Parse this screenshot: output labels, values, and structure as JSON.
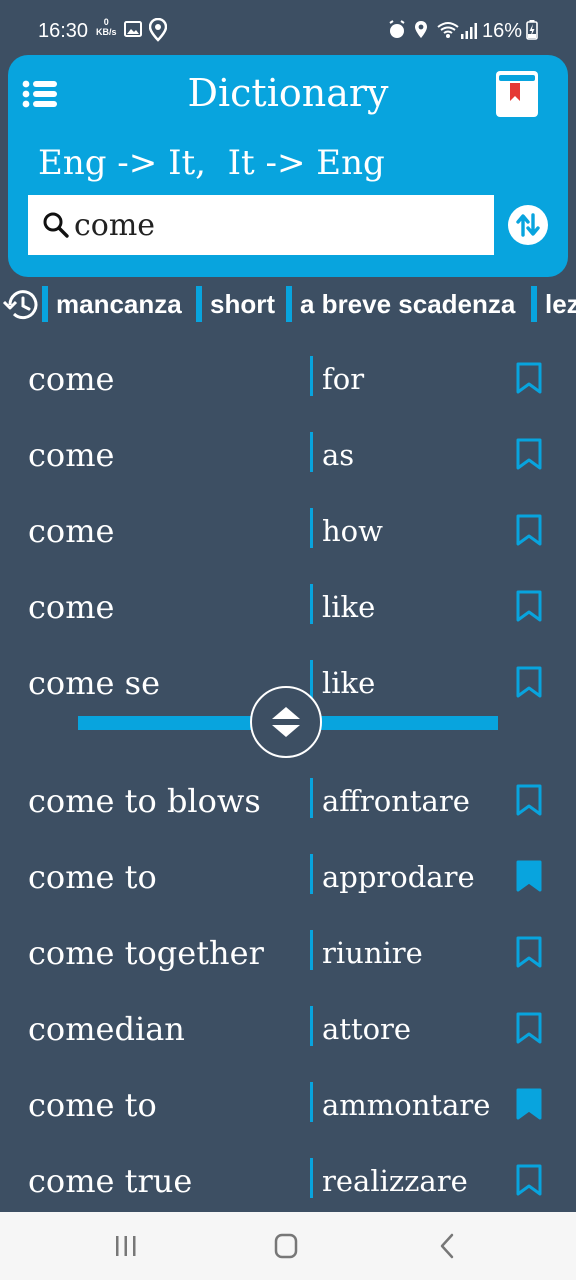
{
  "status_bar": {
    "time": "16:30",
    "net_speed": "0",
    "net_unit": "KB/s",
    "battery": "16%",
    "icons": [
      "image-icon",
      "location-icon",
      "alarm-icon",
      "location-icon",
      "wifi-icon",
      "signal-icon",
      "battery-charging-icon"
    ]
  },
  "header": {
    "title": "Dictionary",
    "subtitle": "Eng -> It,  It -> Eng",
    "search_value": "come",
    "menu_icon": "list-icon",
    "bookmarks_icon": "bookmark-book-icon",
    "swap_icon": "swap-vertical-icon"
  },
  "history": {
    "icon": "history-icon",
    "items": [
      "mancanza",
      "short",
      "a breve scadenza",
      "lez"
    ]
  },
  "results": [
    {
      "word": "come",
      "translation": "for",
      "bookmarked": false
    },
    {
      "word": "come",
      "translation": "as",
      "bookmarked": false
    },
    {
      "word": "come",
      "translation": "how",
      "bookmarked": false
    },
    {
      "word": "come",
      "translation": "like",
      "bookmarked": false
    },
    {
      "word": "come se",
      "translation": "like",
      "bookmarked": false
    },
    {
      "word": "come to blows",
      "translation": "affrontare",
      "bookmarked": false
    },
    {
      "word": "come to",
      "translation": "approdare",
      "bookmarked": true
    },
    {
      "word": "come together",
      "translation": "riunire",
      "bookmarked": false
    },
    {
      "word": "comedian",
      "translation": "attore",
      "bookmarked": false
    },
    {
      "word": "come to",
      "translation": "ammontare",
      "bookmarked": true
    },
    {
      "word": "come true",
      "translation": "realizzare",
      "bookmarked": false
    }
  ],
  "colors": {
    "accent": "#08a4de",
    "background": "#3d4f63",
    "nav_bar": "#f6f6f6"
  }
}
